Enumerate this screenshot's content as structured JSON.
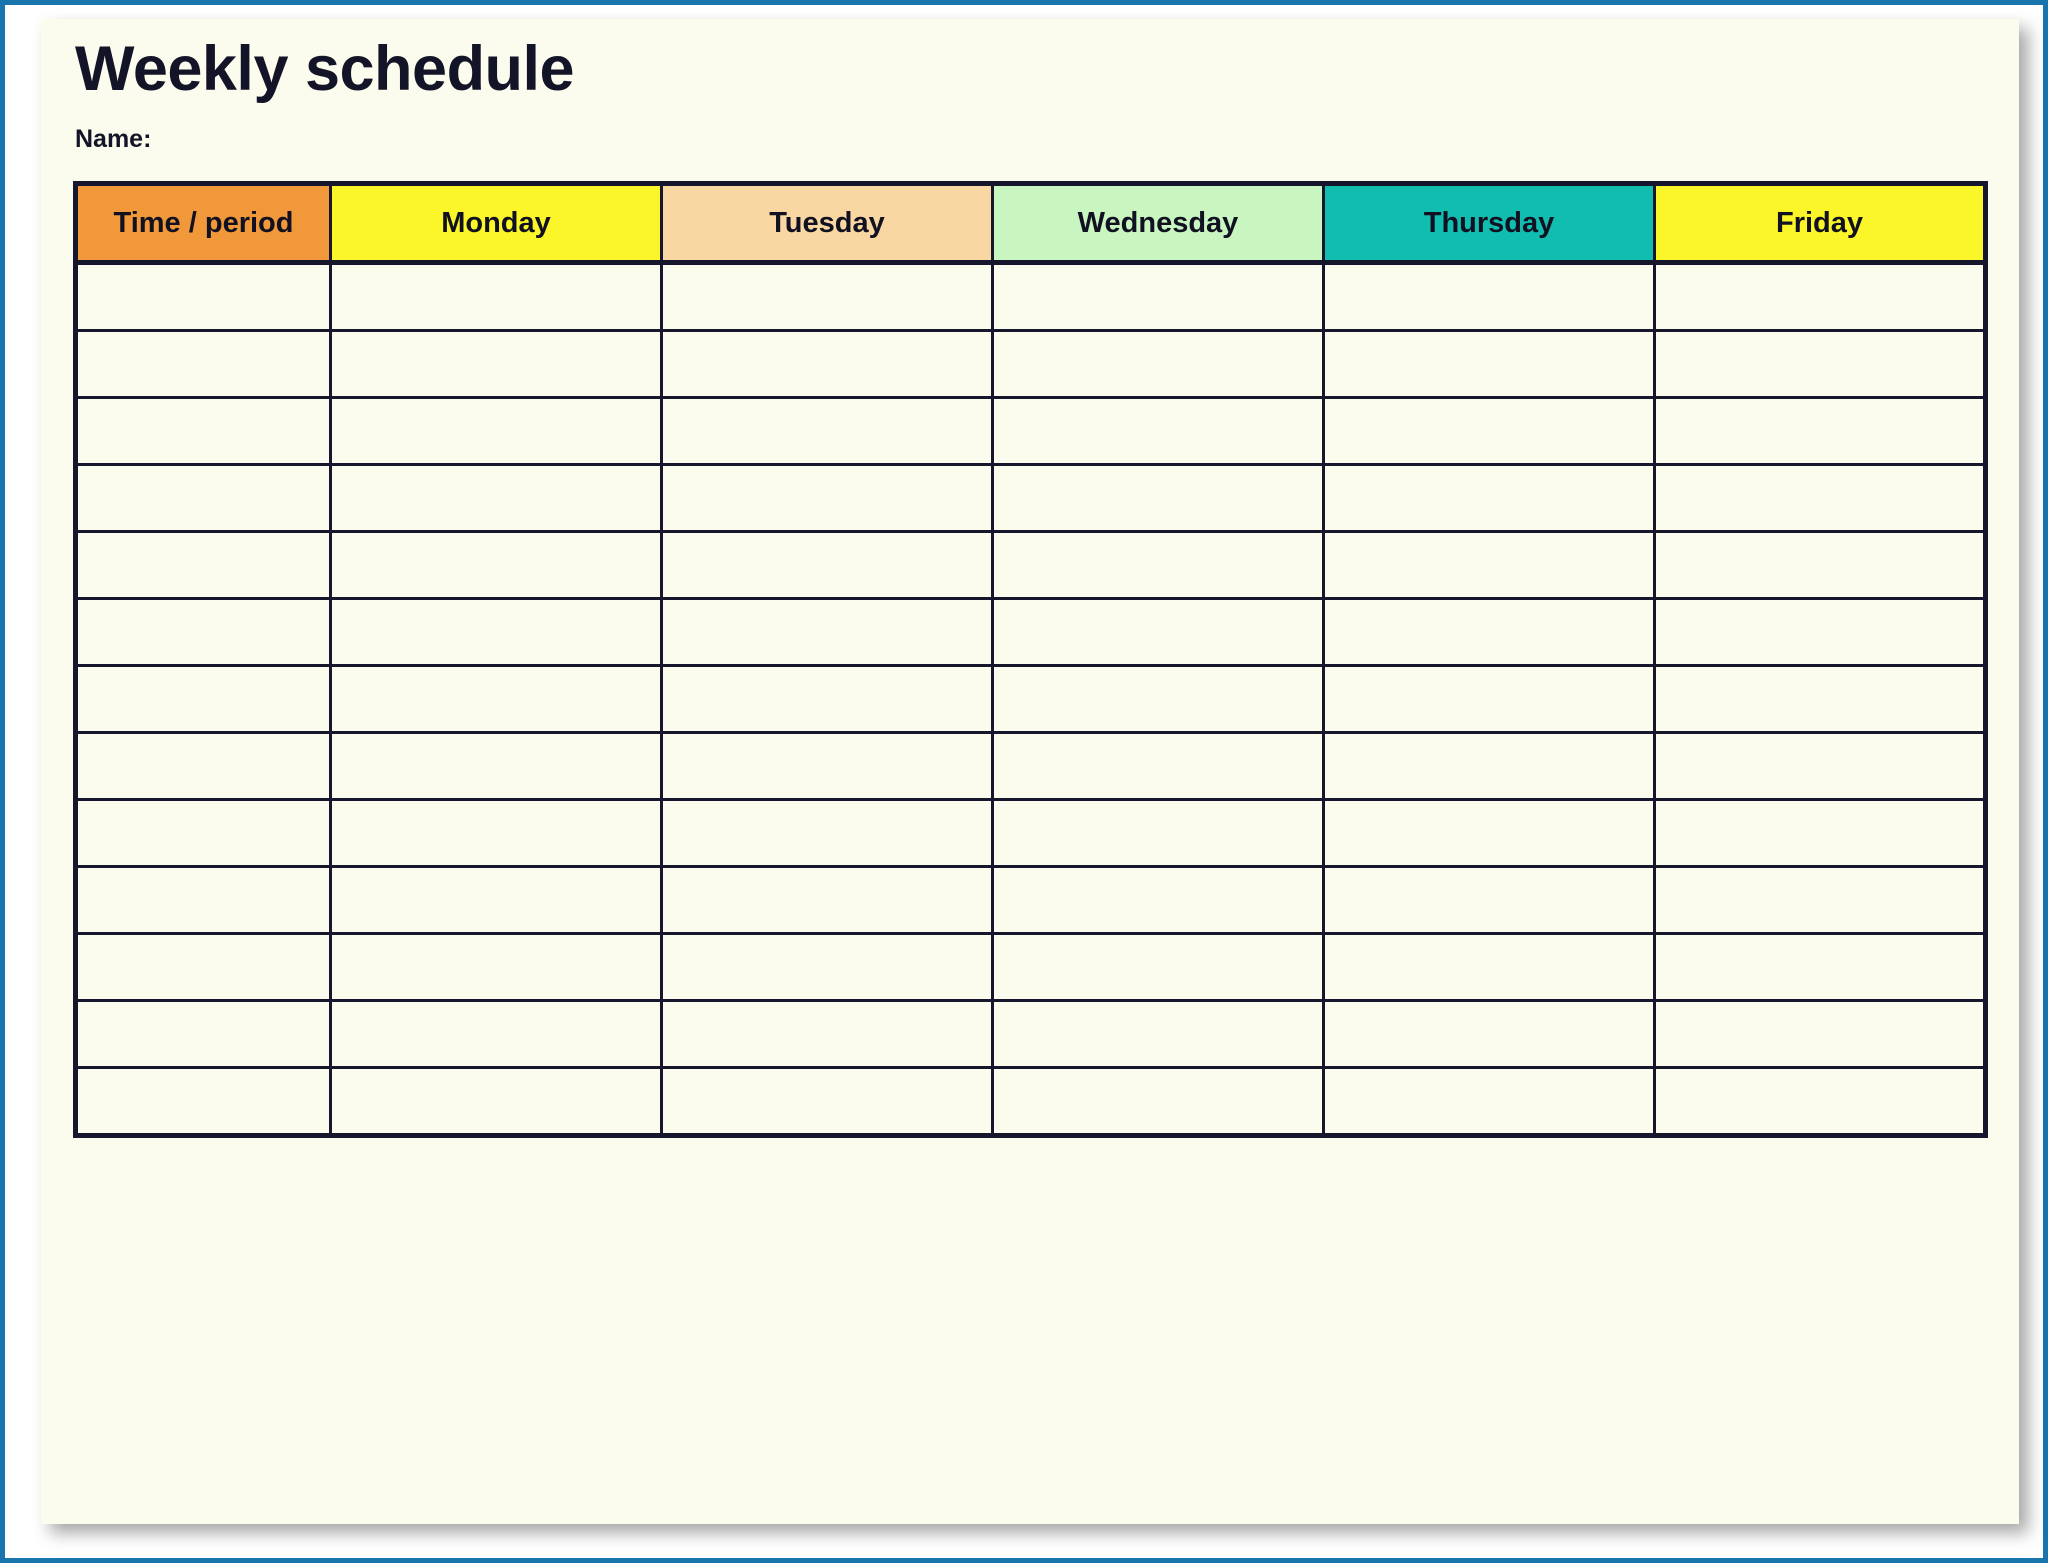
{
  "document": {
    "title": "Weekly schedule",
    "name_label": "Name:",
    "name_value": ""
  },
  "table": {
    "columns": [
      {
        "label": "Time / period",
        "color": "#f0983a",
        "key": "time-period"
      },
      {
        "label": "Monday",
        "color": "#faf629",
        "key": "monday"
      },
      {
        "label": "Tuesday",
        "color": "#f9d7a2",
        "key": "tuesday"
      },
      {
        "label": "Wednesday",
        "color": "#c9f5c0",
        "key": "wednesday"
      },
      {
        "label": "Thursday",
        "color": "#10bdae",
        "key": "thursday"
      },
      {
        "label": "Friday",
        "color": "#faf629",
        "key": "friday"
      }
    ],
    "row_count": 13,
    "rows": [
      [
        "",
        "",
        "",
        "",
        "",
        ""
      ],
      [
        "",
        "",
        "",
        "",
        "",
        ""
      ],
      [
        "",
        "",
        "",
        "",
        "",
        ""
      ],
      [
        "",
        "",
        "",
        "",
        "",
        ""
      ],
      [
        "",
        "",
        "",
        "",
        "",
        ""
      ],
      [
        "",
        "",
        "",
        "",
        "",
        ""
      ],
      [
        "",
        "",
        "",
        "",
        "",
        ""
      ],
      [
        "",
        "",
        "",
        "",
        "",
        ""
      ],
      [
        "",
        "",
        "",
        "",
        "",
        ""
      ],
      [
        "",
        "",
        "",
        "",
        "",
        ""
      ],
      [
        "",
        "",
        "",
        "",
        "",
        ""
      ],
      [
        "",
        "",
        "",
        "",
        "",
        ""
      ],
      [
        "",
        "",
        "",
        "",
        "",
        ""
      ]
    ]
  },
  "theme": {
    "frame_color": "#1a75ad",
    "page_background": "#fbfbee",
    "grid_color": "#16162c",
    "text_color": "#141428"
  }
}
